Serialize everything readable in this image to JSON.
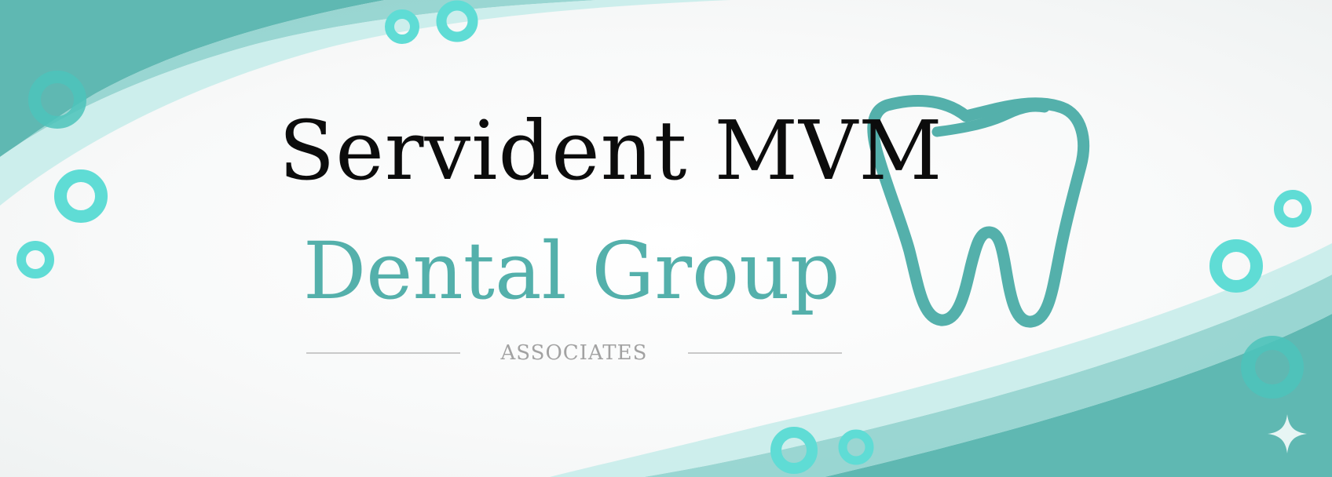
{
  "brand": {
    "line1": "Servident MVM",
    "line2": "Dental Group",
    "tagline": "ASSOCIATES"
  },
  "colors": {
    "teal": "#54b0ab",
    "teal_light": "#5fdcd5",
    "text_dark": "#0c0c0c",
    "tagline_grey": "#a2a2a2"
  },
  "icons": {
    "logo": "tooth-icon",
    "watermark": "sparkle-icon"
  }
}
